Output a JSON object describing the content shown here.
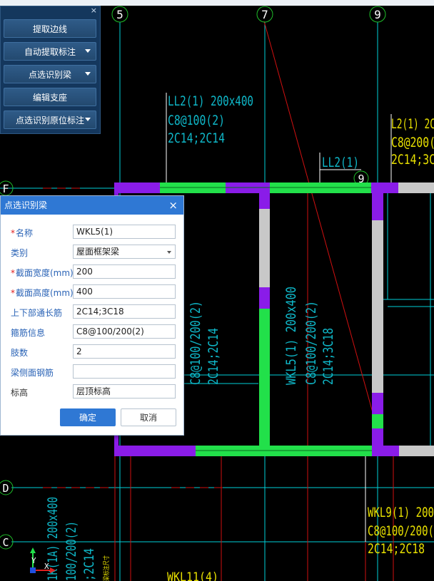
{
  "tool_panel": {
    "close": "×",
    "buttons": [
      {
        "label": "提取边线"
      },
      {
        "label": "自动提取标注"
      },
      {
        "label": "点选识别梁"
      },
      {
        "label": "编辑支座"
      },
      {
        "label": "点选识别原位标注"
      }
    ]
  },
  "dialog": {
    "title": "点选识别梁",
    "close": "×",
    "fields": [
      {
        "label": "名称",
        "value": "WKL5(1)",
        "required": true
      },
      {
        "label": "类别",
        "value": "屋面框架梁",
        "required": false
      },
      {
        "label": "截面宽度(mm)",
        "value": "200",
        "required": true
      },
      {
        "label": "截面高度(mm)",
        "value": "400",
        "required": true
      },
      {
        "label": "上下部通长筋",
        "value": "2C14;3C18",
        "required": false
      },
      {
        "label": "箍筋信息",
        "value": "C8@100/200(2)",
        "required": false
      },
      {
        "label": "肢数",
        "value": "2",
        "required": false
      },
      {
        "label": "梁侧面钢筋",
        "value": "",
        "required": false
      },
      {
        "label": "标高",
        "value": "层顶标高",
        "required": false
      }
    ],
    "ok": "确定",
    "cancel": "取消"
  },
  "cad": {
    "axis_labels": {
      "a5": "5",
      "a7": "7",
      "a9": "9",
      "a9b": "9",
      "aF": "F",
      "aD": "D",
      "aC": "C"
    },
    "annotations": {
      "ll2_title": "LL2(1) 200x400",
      "ll2_stirrup": "C8@100(2)",
      "ll2_bars": "2C14;2C14",
      "ll2_short": "LL2(1)",
      "ll2_right_title": "L2(1) 2C",
      "ll2_right_stirrup": "C8@200(",
      "ll2_right_bars": "2C14;3C",
      "wkl5_title": "WKL5(1) 200x400",
      "wkl5_stirrup": "C8@100/200(2)",
      "wkl5_bars": "2C14;3C18",
      "left_stirrup": "C8@100/200(2)",
      "left_bars": "2C14;2C14",
      "wkl9_title": "WKL9(1) 200",
      "wkl9_stirrup": "C8@100/200(",
      "wkl9_bars": "2C14;2C18",
      "bottom_title": "1K(1A) 200x400",
      "bottom_stirrup": "100/200(2)",
      "bottom_bars": ";2C14",
      "bottom_small": "梁标注尺寸",
      "wkl11": "WKL11(4)"
    },
    "ucs": {
      "y": "Y",
      "x": "X"
    },
    "colors": {
      "grid": "#00cfd8",
      "beam_green": "#22e04a",
      "beam_purple": "#8a1ce8",
      "axis_red": "#d01010",
      "text_cyan": "#0fb7c8",
      "text_yellow": "#e8e000"
    }
  }
}
